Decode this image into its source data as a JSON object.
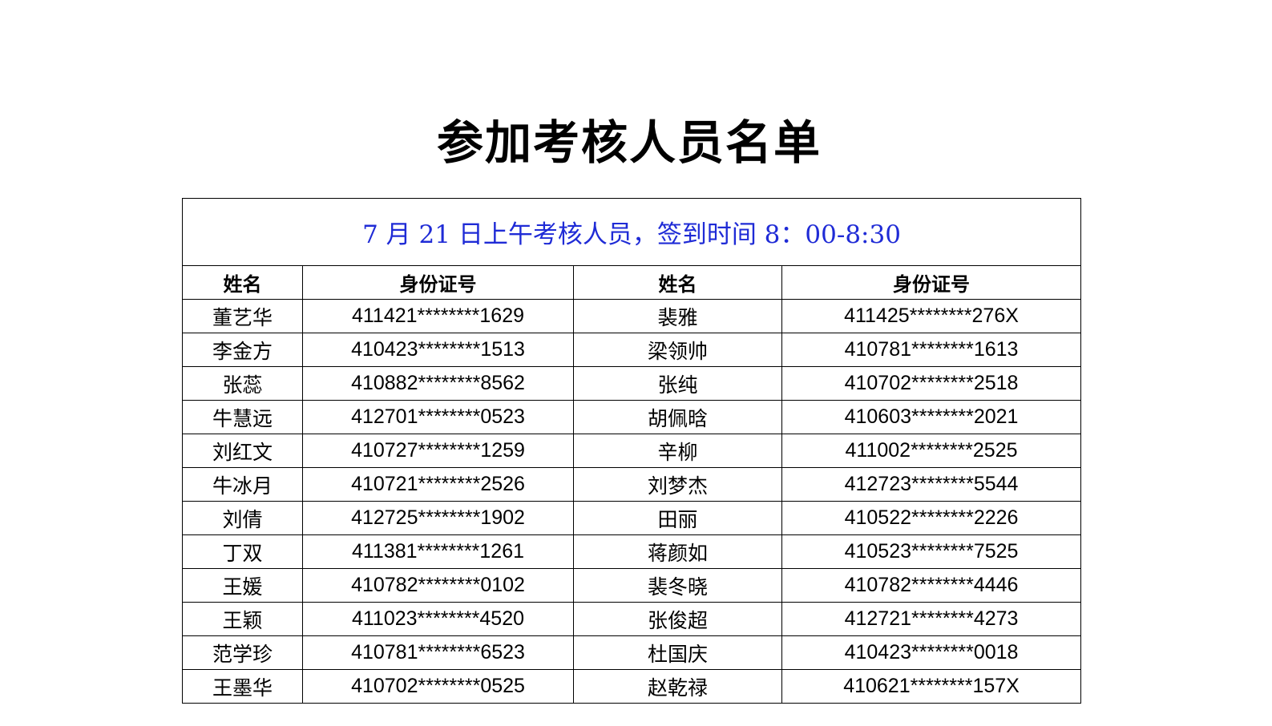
{
  "document": {
    "title": "参加考核人员名单"
  },
  "table": {
    "session": "7 月 21 日上午考核人员，签到时间 8：00-8:30",
    "headers": {
      "name_left": "姓名",
      "id_left": "身份证号",
      "name_right": "姓名",
      "id_right": "身份证号"
    },
    "rows": [
      {
        "left_name": "董艺华",
        "left_id": "411421********1629",
        "right_name": "裴雅",
        "right_id": "411425********276X"
      },
      {
        "left_name": "李金方",
        "left_id": "410423********1513",
        "right_name": "梁领帅",
        "right_id": "410781********1613"
      },
      {
        "left_name": "张蕊",
        "left_id": "410882********8562",
        "right_name": "张纯",
        "right_id": "410702********2518"
      },
      {
        "left_name": "牛慧远",
        "left_id": "412701********0523",
        "right_name": "胡佩晗",
        "right_id": "410603********2021"
      },
      {
        "left_name": "刘红文",
        "left_id": "410727********1259",
        "right_name": "辛柳",
        "right_id": "411002********2525"
      },
      {
        "left_name": "牛冰月",
        "left_id": "410721********2526",
        "right_name": "刘梦杰",
        "right_id": "412723********5544"
      },
      {
        "left_name": "刘倩",
        "left_id": "412725********1902",
        "right_name": "田丽",
        "right_id": "410522********2226"
      },
      {
        "left_name": "丁双",
        "left_id": "411381********1261",
        "right_name": "蒋颜如",
        "right_id": "410523********7525"
      },
      {
        "left_name": "王媛",
        "left_id": "410782********0102",
        "right_name": "裴冬晓",
        "right_id": "410782********4446"
      },
      {
        "left_name": "王颖",
        "left_id": "411023********4520",
        "right_name": "张俊超",
        "right_id": "412721********4273"
      },
      {
        "left_name": "范学珍",
        "left_id": "410781********6523",
        "right_name": "杜国庆",
        "right_id": "410423********0018"
      },
      {
        "left_name": "王墨华",
        "left_id": "410702********0525",
        "right_name": "赵乾禄",
        "right_id": "410621********157X"
      }
    ]
  }
}
